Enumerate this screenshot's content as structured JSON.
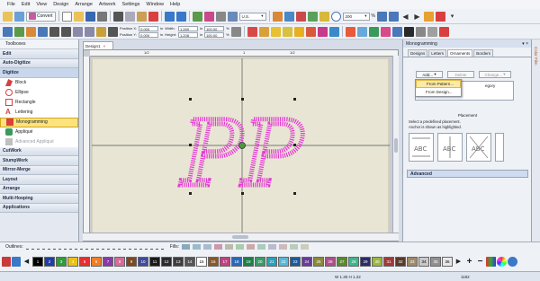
{
  "menu": [
    "File",
    "Edit",
    "View",
    "Design",
    "Arrange",
    "Artwork",
    "Settings",
    "Window",
    "Help"
  ],
  "toolbar": {
    "convert_label": "Convert",
    "units": "U.S.",
    "zoom": "200",
    "zoom_unit": "%",
    "position_x_label": "Position X:",
    "position_y_label": "Position Y:",
    "position_x": "0.000",
    "position_y": "0.000",
    "width_label": "Width:",
    "height_label": "Height:",
    "width": "1.269",
    "height": "1.208",
    "unit_in": "in",
    "scale_w": "100.00",
    "scale_h": "100.00",
    "scale_unit": "%"
  },
  "left_panel": {
    "title": "Toolboxes",
    "sections_top": [
      "Edit",
      "Auto-Digitize",
      "Digitize"
    ],
    "digitize_items": [
      {
        "label": "Block",
        "selected": false,
        "disabled": false
      },
      {
        "label": "Ellipse",
        "selected": false,
        "disabled": false
      },
      {
        "label": "Rectangle",
        "selected": false,
        "disabled": false
      },
      {
        "label": "Lettering",
        "selected": false,
        "disabled": false
      },
      {
        "label": "Monogramming",
        "selected": true,
        "disabled": false
      },
      {
        "label": "Appliqué",
        "selected": false,
        "disabled": false
      },
      {
        "label": "Advanced Appliqué",
        "selected": false,
        "disabled": true
      }
    ],
    "sections_bottom": [
      "CutWork",
      "StumpWork",
      "Mirror-Merge",
      "Layout",
      "Arrange",
      "Multi-Hooping",
      "Applications"
    ]
  },
  "document": {
    "tab_label": "Design1",
    "close_glyph": "×",
    "ruler_labels": [
      "1/2",
      "1",
      "1/2"
    ],
    "monogram_text": "PP",
    "monogram_color": "#e43ad3"
  },
  "right_panel": {
    "title": "Monogramming",
    "tabs": [
      "Designs",
      "Letters",
      "Ornaments",
      "Borders"
    ],
    "active_tab": "Ornaments",
    "buttons": {
      "add": "Add...",
      "delete": "Delete",
      "change": "Change..."
    },
    "dropdown_items": [
      "From Pattern...",
      "From Design..."
    ],
    "list_partial_text": "egory",
    "placement_title": "Placement",
    "placement_desc": [
      "Select a predefined placement.",
      "Anchor is shown as highlighted."
    ],
    "advanced_label": "Advanced",
    "color_film_label": "Color Film"
  },
  "outlines_label": "Outlines:",
  "fills_label": "Fills:",
  "palette": [
    {
      "n": "1",
      "c": "#000000"
    },
    {
      "n": "2",
      "c": "#1f3fa6"
    },
    {
      "n": "3",
      "c": "#2f9e3a"
    },
    {
      "n": "4",
      "c": "#e8c21a"
    },
    {
      "n": "5",
      "c": "#e53030"
    },
    {
      "n": "6",
      "c": "#f07f24"
    },
    {
      "n": "7",
      "c": "#8a3aa8"
    },
    {
      "n": "8",
      "c": "#d96a9a"
    },
    {
      "n": "9",
      "c": "#7c4a20"
    },
    {
      "n": "10",
      "c": "#3f4aa0"
    },
    {
      "n": "11",
      "c": "#1a1a1a"
    },
    {
      "n": "12",
      "c": "#2a2a2a"
    },
    {
      "n": "13",
      "c": "#3d3d3d"
    },
    {
      "n": "14",
      "c": "#555555"
    },
    {
      "n": "15",
      "c": "#ffffff"
    },
    {
      "n": "16",
      "c": "#8a5a2a"
    },
    {
      "n": "17",
      "c": "#c24080"
    },
    {
      "n": "18",
      "c": "#2a68b8"
    },
    {
      "n": "19",
      "c": "#1e7f4a"
    },
    {
      "n": "20",
      "c": "#3a9a6a"
    },
    {
      "n": "21",
      "c": "#2aa0b8"
    },
    {
      "n": "22",
      "c": "#56b8d8"
    },
    {
      "n": "23",
      "c": "#1a5a9a"
    },
    {
      "n": "24",
      "c": "#6a3a9a"
    },
    {
      "n": "25",
      "c": "#8a8a3a"
    },
    {
      "n": "26",
      "c": "#b0508a"
    },
    {
      "n": "27",
      "c": "#5a8a2a"
    },
    {
      "n": "28",
      "c": "#3ab88a"
    },
    {
      "n": "29",
      "c": "#2a2a6a"
    },
    {
      "n": "30",
      "c": "#9ab83a"
    },
    {
      "n": "31",
      "c": "#a03a3a"
    },
    {
      "n": "32",
      "c": "#5a3a2a"
    },
    {
      "n": "33",
      "c": "#a08a6a"
    },
    {
      "n": "34",
      "c": "#c8c8c8"
    },
    {
      "n": "35",
      "c": "#909090"
    },
    {
      "n": "36",
      "c": "#e8e8e8"
    }
  ],
  "status": {
    "dimensions": "W 1.30 H 1.22",
    "count": "1182"
  }
}
